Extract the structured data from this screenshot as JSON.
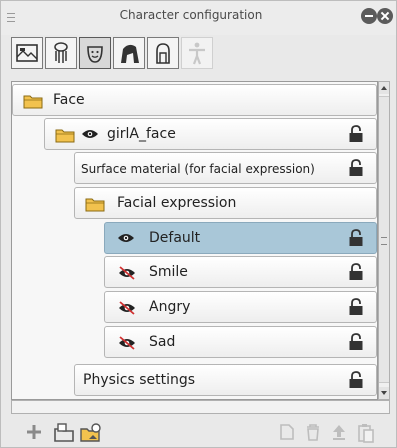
{
  "window": {
    "title": "Character configuration"
  },
  "toolbar": {
    "tools": [
      {
        "icon": "layout-image-icon",
        "state": "normal"
      },
      {
        "icon": "body-type-icon",
        "state": "normal"
      },
      {
        "icon": "face-icon",
        "state": "active"
      },
      {
        "icon": "hair-icon",
        "state": "normal"
      },
      {
        "icon": "accessory-icon",
        "state": "normal"
      },
      {
        "icon": "pose-figure-icon",
        "state": "disabled"
      }
    ]
  },
  "tree": {
    "rows": [
      {
        "label": "Face",
        "icon": "folder-icon",
        "visible": null,
        "locked": false
      },
      {
        "label": "girlA_face",
        "icon": "folder-icon",
        "visible": true,
        "locked": true
      },
      {
        "label": "Surface material (for facial expression)",
        "icon": null,
        "visible": null,
        "locked": true
      },
      {
        "label": "Facial expression",
        "icon": "folder-icon",
        "visible": null,
        "locked": false
      },
      {
        "label": "Default",
        "icon": null,
        "visible": true,
        "locked": true,
        "selected": true
      },
      {
        "label": "Smile",
        "icon": null,
        "visible": false,
        "locked": true
      },
      {
        "label": "Angry",
        "icon": null,
        "visible": false,
        "locked": true
      },
      {
        "label": "Sad",
        "icon": null,
        "visible": false,
        "locked": true
      },
      {
        "label": "Physics settings",
        "icon": null,
        "visible": null,
        "locked": true
      }
    ]
  },
  "colors": {
    "selected_row": "#a9c7d8",
    "panel_bg": "#e9e9e9",
    "folder": "#f2c24e"
  },
  "bottom_bar": {
    "left": [
      "add-icon",
      "new-folder-icon",
      "add-folder-image-icon"
    ],
    "right": [
      "duplicate-icon",
      "delete-icon",
      "upload-icon",
      "paste-icon"
    ]
  }
}
